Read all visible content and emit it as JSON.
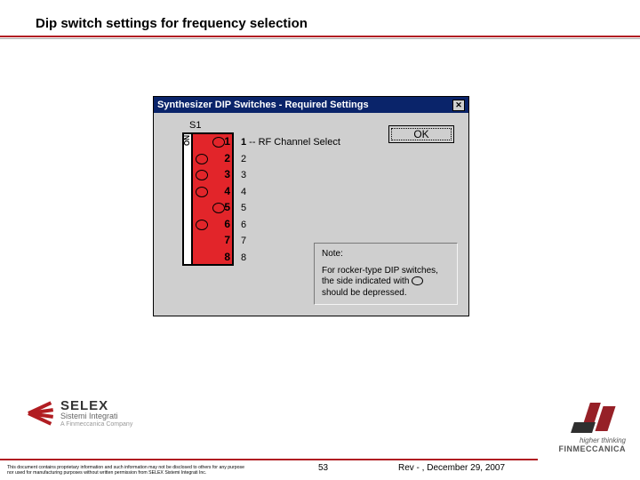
{
  "slide": {
    "title": "Dip switch settings for frequency selection",
    "page_number": "53",
    "revision": "Rev - , December 29, 2007",
    "disclaimer": "This document contains proprietary information and such information may not be disclosed to others for any purpose nor used for manufacturing purposes without written permission from SELEX Sistemi Integrati Inc."
  },
  "dialog": {
    "title": "Synthesizer DIP Switches - Required Settings",
    "ok_label": "OK",
    "close_glyph": "✕",
    "s1_label": "S1",
    "on_label": "ON",
    "dip_rows": [
      {
        "n": "1",
        "pos": "right",
        "label_prefix": "1",
        "label_rest": " -- RF Channel Select"
      },
      {
        "n": "2",
        "pos": "left",
        "label_prefix": "2",
        "label_rest": ""
      },
      {
        "n": "3",
        "pos": "left",
        "label_prefix": "3",
        "label_rest": ""
      },
      {
        "n": "4",
        "pos": "left",
        "label_prefix": "4",
        "label_rest": ""
      },
      {
        "n": "5",
        "pos": "right",
        "label_prefix": "5",
        "label_rest": ""
      },
      {
        "n": "6",
        "pos": "left",
        "label_prefix": "6",
        "label_rest": ""
      },
      {
        "n": "7",
        "pos": "none",
        "label_prefix": "7",
        "label_rest": ""
      },
      {
        "n": "8",
        "pos": "none",
        "label_prefix": "8",
        "label_rest": ""
      }
    ],
    "note": {
      "title": "Note:",
      "line1": "For rocker-type DIP switches, the side indicated with ",
      "line2": "should be depressed."
    }
  },
  "logos": {
    "selex_name": "SELEX",
    "selex_sub": "Sistemi Integrati",
    "selex_tag": "A Finmeccanica Company",
    "finm_tag": "higher thinking",
    "finm_name": "FINMECCANICA"
  }
}
